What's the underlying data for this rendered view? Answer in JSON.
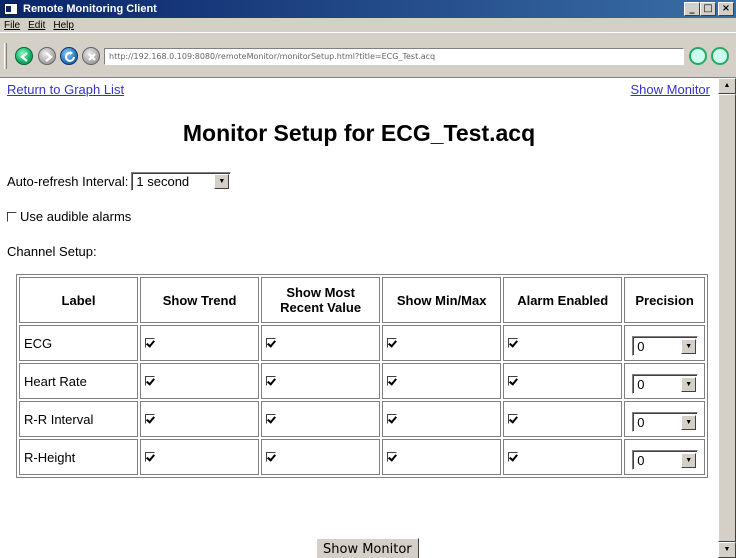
{
  "window": {
    "title": "Remote Monitoring Client"
  },
  "menu": {
    "items": [
      "File",
      "Edit",
      "Help"
    ]
  },
  "address": {
    "url": "http://192.168.0.109:8080/remoteMonitor/monitorSetup.html?title=ECG_Test.acq"
  },
  "links": {
    "return": "Return to Graph List",
    "show_monitor": "Show Monitor"
  },
  "page": {
    "title": "Monitor Setup for ECG_Test.acq",
    "refresh_label": "Auto-refresh Interval:",
    "refresh_value": "1 second",
    "alarm_label": "Use audible alarms",
    "channel_setup_label": "Channel Setup:"
  },
  "table": {
    "headers": [
      "Label",
      "Show Trend",
      "Show Most Recent Value",
      "Show Min/Max",
      "Alarm Enabled",
      "Precision"
    ],
    "rows": [
      {
        "label": "ECG",
        "precision": "0"
      },
      {
        "label": "Heart Rate",
        "precision": "0"
      },
      {
        "label": "R-R Interval",
        "precision": "0"
      },
      {
        "label": "R-Height",
        "precision": "0"
      }
    ]
  },
  "button": {
    "show_monitor": "Show Monitor"
  },
  "colors": {
    "link": "#3333cc",
    "titlebar": "#0a246a"
  }
}
